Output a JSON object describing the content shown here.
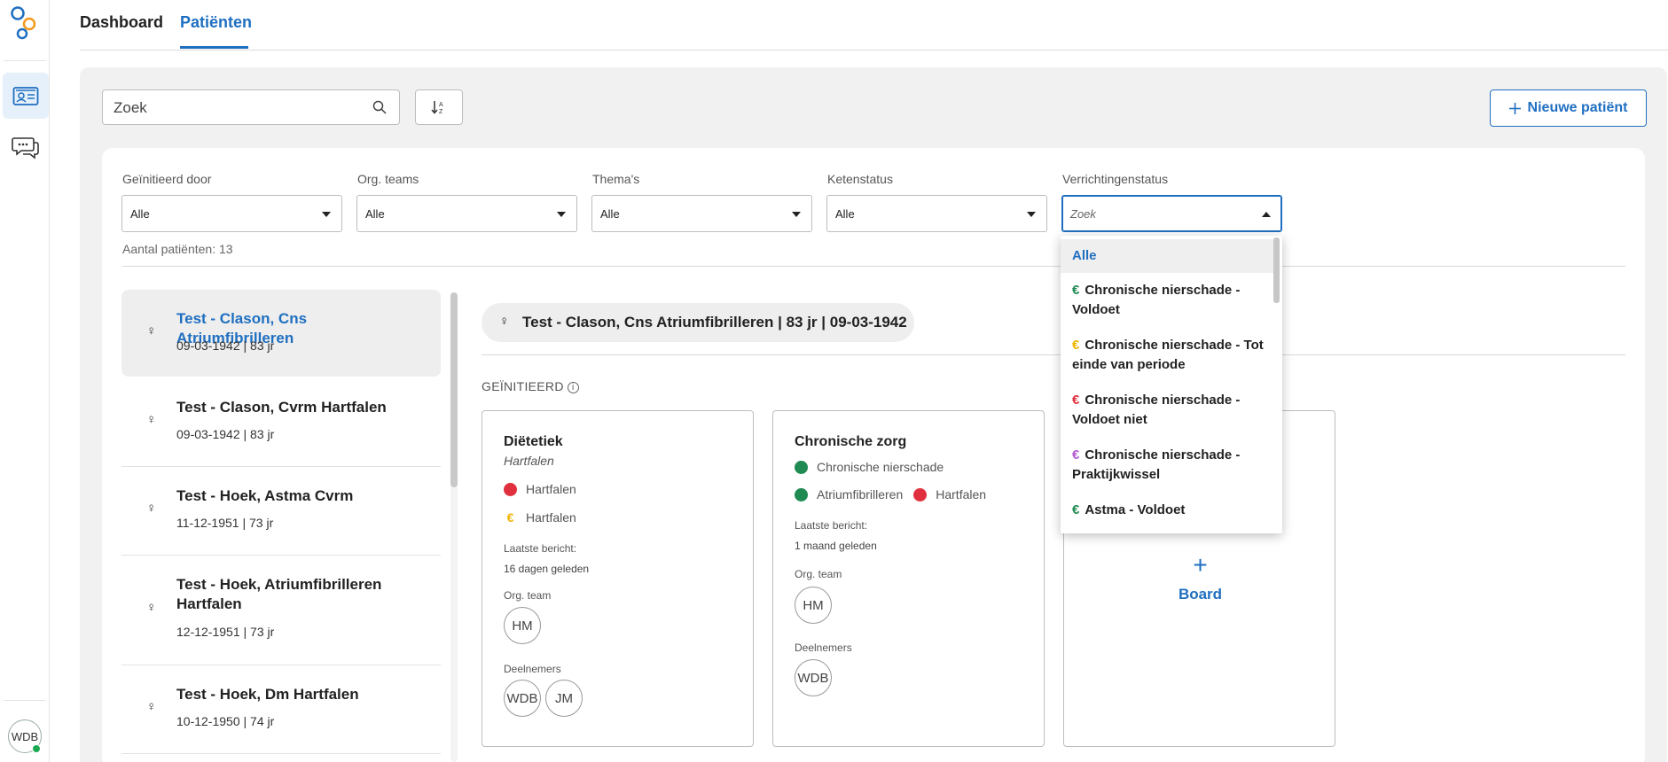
{
  "tabs": {
    "dashboard": "Dashboard",
    "patients": "Patiënten"
  },
  "rail": {
    "avatar_initials": "WDB"
  },
  "toolbar": {
    "search_placeholder": "Zoek",
    "new_patient_label": "Nieuwe patiënt"
  },
  "filters": [
    {
      "label": "Geïnitieerd door",
      "value": "Alle"
    },
    {
      "label": "Org. teams",
      "value": "Alle"
    },
    {
      "label": "Thema's",
      "value": "Alle"
    },
    {
      "label": "Ketenstatus",
      "value": "Alle"
    },
    {
      "label": "Verrichtingenstatus",
      "value": "Zoek"
    }
  ],
  "patient_count": "Aantal patiënten: 13",
  "patients": [
    {
      "name": "Test - Clason, Cns Atriumfibrilleren",
      "meta": "09-03-1942 | 83 jr",
      "gender": "♀"
    },
    {
      "name": "Test - Clason, Cvrm Hartfalen",
      "meta": "09-03-1942 | 83 jr",
      "gender": "♀"
    },
    {
      "name": "Test - Hoek, Astma Cvrm",
      "meta": "11-12-1951 | 73 jr",
      "gender": "♀"
    },
    {
      "name": "Test - Hoek, Atriumfibrilleren Hartfalen",
      "meta": "12-12-1951 | 73 jr",
      "gender": "♀"
    },
    {
      "name": "Test - Hoek, Dm Hartfalen",
      "meta": "10-12-1950 | 74 jr",
      "gender": "♀"
    }
  ],
  "detail": {
    "header": "Test - Clason, Cns Atriumfibrilleren | 83 jr | 09-03-1942",
    "section": "GEÏNITIEERD",
    "cards": [
      {
        "title": "Diëtetiek",
        "subtitle": "Hartfalen",
        "item1": "Hartfalen",
        "item2": "Hartfalen",
        "last_label": "Laatste bericht:",
        "last_value": "16 dagen geleden",
        "team_label": "Org. team",
        "team_chip": "HM",
        "members_label": "Deelnemers",
        "member1": "WDB",
        "member2": "JM"
      },
      {
        "title": "Chronische zorg",
        "item1": "Chronische nierschade",
        "item2": "Atriumfibrilleren",
        "item3": "Hartfalen",
        "last_label": "Laatste bericht:",
        "last_value": "1 maand geleden",
        "team_label": "Org. team",
        "team_chip": "HM",
        "members_label": "Deelnemers",
        "member1": "WDB"
      }
    ],
    "board_label": "Board"
  },
  "dropdown": {
    "options": [
      {
        "label": "Alle",
        "euro": "",
        "color": "#1f6fc1"
      },
      {
        "label": "Chronische nierschade - Voldoet",
        "euro": "€",
        "color": "#1f8a52"
      },
      {
        "label": "Chronische nierschade - Tot einde van periode",
        "euro": "€",
        "color": "#f0b400"
      },
      {
        "label": "Chronische nierschade - Voldoet niet",
        "euro": "€",
        "color": "#e0303d"
      },
      {
        "label": "Chronische nierschade - Praktijkwissel",
        "euro": "€",
        "color": "#b35ad1"
      },
      {
        "label": "Astma - Voldoet",
        "euro": "€",
        "color": "#1f8a52"
      }
    ]
  },
  "colors": {
    "accent": "#1f6fc1",
    "red": "#e0303d",
    "green": "#1f8a52",
    "amber": "#f0b400"
  },
  "icons": [
    "app-logo-icon",
    "patient-card-icon",
    "chat-icon",
    "search-icon",
    "sort-icon",
    "plus-icon",
    "female-icon",
    "info-icon",
    "euro-icon",
    "caret-down-icon",
    "caret-up-icon"
  ]
}
